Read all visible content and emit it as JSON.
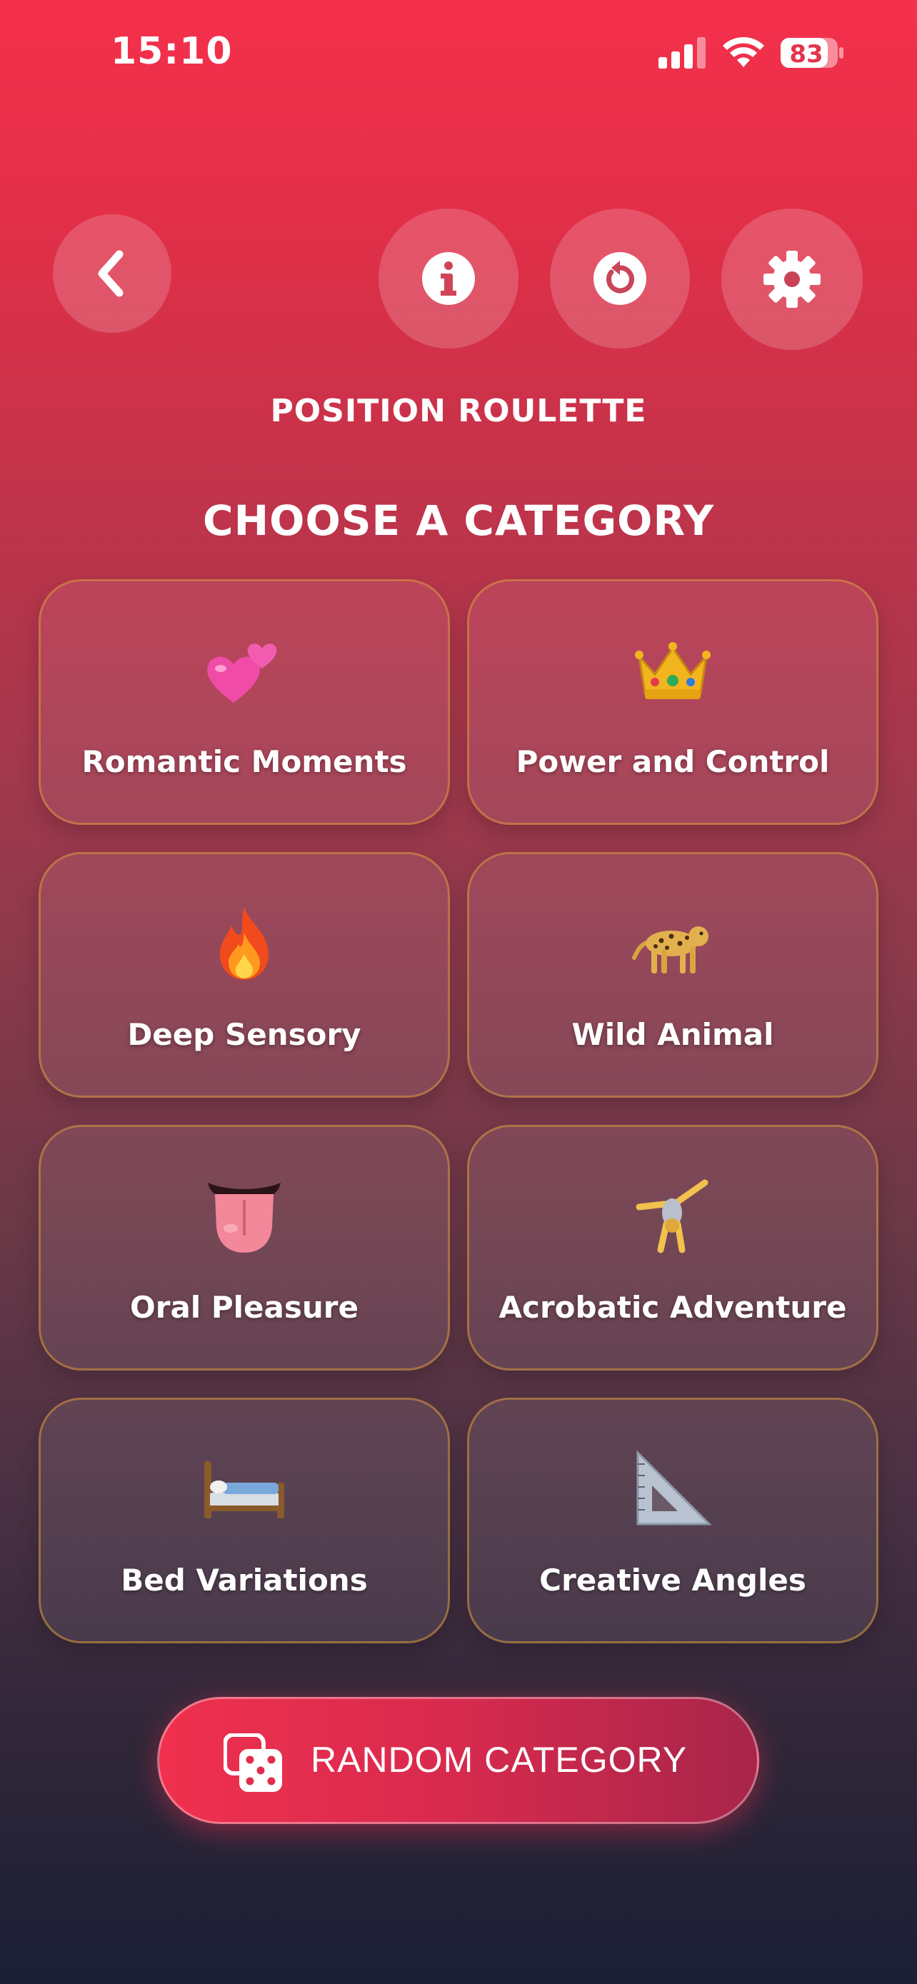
{
  "status_bar": {
    "time": "15:10",
    "battery": "83"
  },
  "header": {
    "subtitle": "POSITION ROULETTE",
    "title": "CHOOSE A CATEGORY"
  },
  "categories": [
    {
      "label": "Romantic Moments",
      "icon": "two-hearts-icon"
    },
    {
      "label": "Power and Control",
      "icon": "crown-icon"
    },
    {
      "label": "Deep Sensory",
      "icon": "fire-icon"
    },
    {
      "label": "Wild Animal",
      "icon": "leopard-icon"
    },
    {
      "label": "Oral Pleasure",
      "icon": "tongue-icon"
    },
    {
      "label": "Acrobatic Adventure",
      "icon": "cartwheel-icon"
    },
    {
      "label": "Bed Variations",
      "icon": "bed-icon"
    },
    {
      "label": "Creative Angles",
      "icon": "triangular-ruler-icon"
    }
  ],
  "random_button": {
    "label": "RANDOM CATEGORY",
    "icon": "dice-icon"
  },
  "colors": {
    "accent": "#f0304e",
    "card_border": "#d6963c"
  }
}
